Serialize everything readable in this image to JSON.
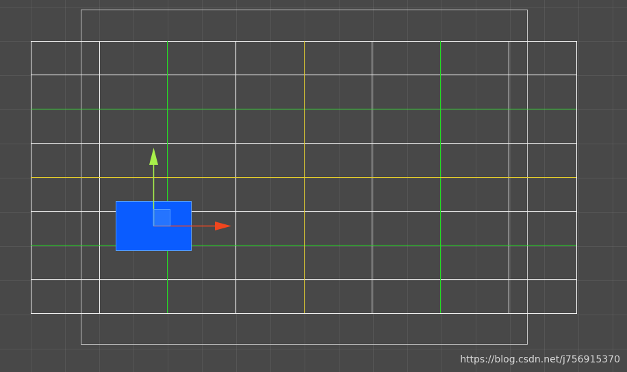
{
  "colors": {
    "background": "#484848",
    "grid_white": "#f0f0f0",
    "grid_green": "#22dd22",
    "grid_yellow": "#e6cf2a",
    "camera_frame": "#c8c8c8",
    "selected_rect_fill": "#0a5cff",
    "gizmo_x_axis": "#f0461e",
    "gizmo_y_axis": "#a8f04a"
  },
  "icons": {
    "move_x": "move-x-arrow-icon",
    "move_y": "move-y-arrow-icon",
    "move_xy": "move-plane-handle-icon"
  },
  "watermark": {
    "text": "https://blog.csdn.net/j756915370"
  }
}
